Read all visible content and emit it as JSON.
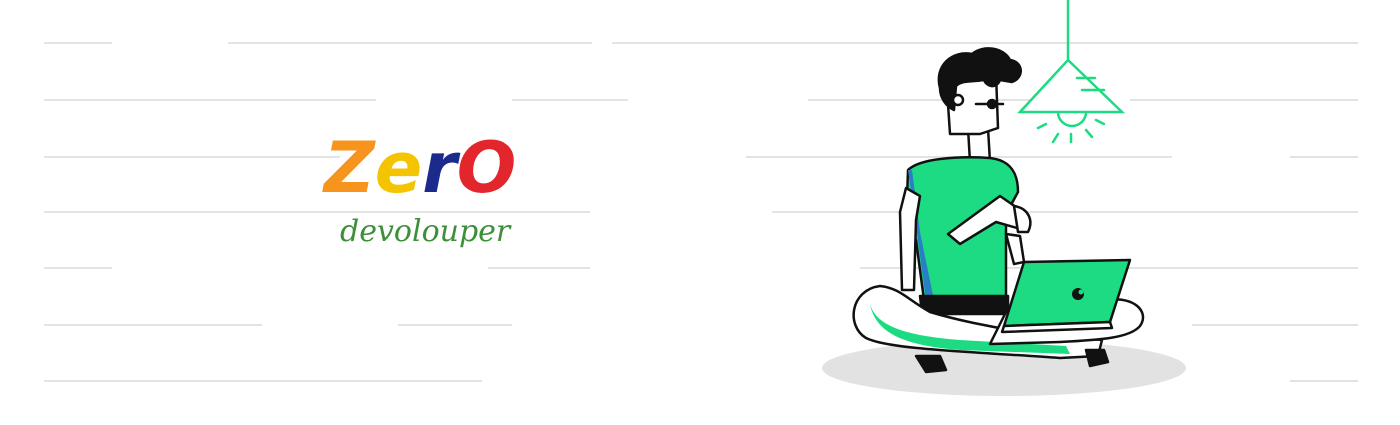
{
  "logo": {
    "letters": [
      {
        "char": "Z",
        "color": "#f7941d"
      },
      {
        "char": "e",
        "color": "#f5c400"
      },
      {
        "char": "r",
        "color": "#1c2a8c"
      },
      {
        "char": "O",
        "color": "#e3262b"
      }
    ],
    "subtitle": "devolouper",
    "subtitle_color": "#3e8f3a"
  },
  "illustration": {
    "subject": "person-sitting-with-laptop-under-lamp",
    "accent_color": "#1ddb82",
    "line_color": "#e6e6e6"
  }
}
